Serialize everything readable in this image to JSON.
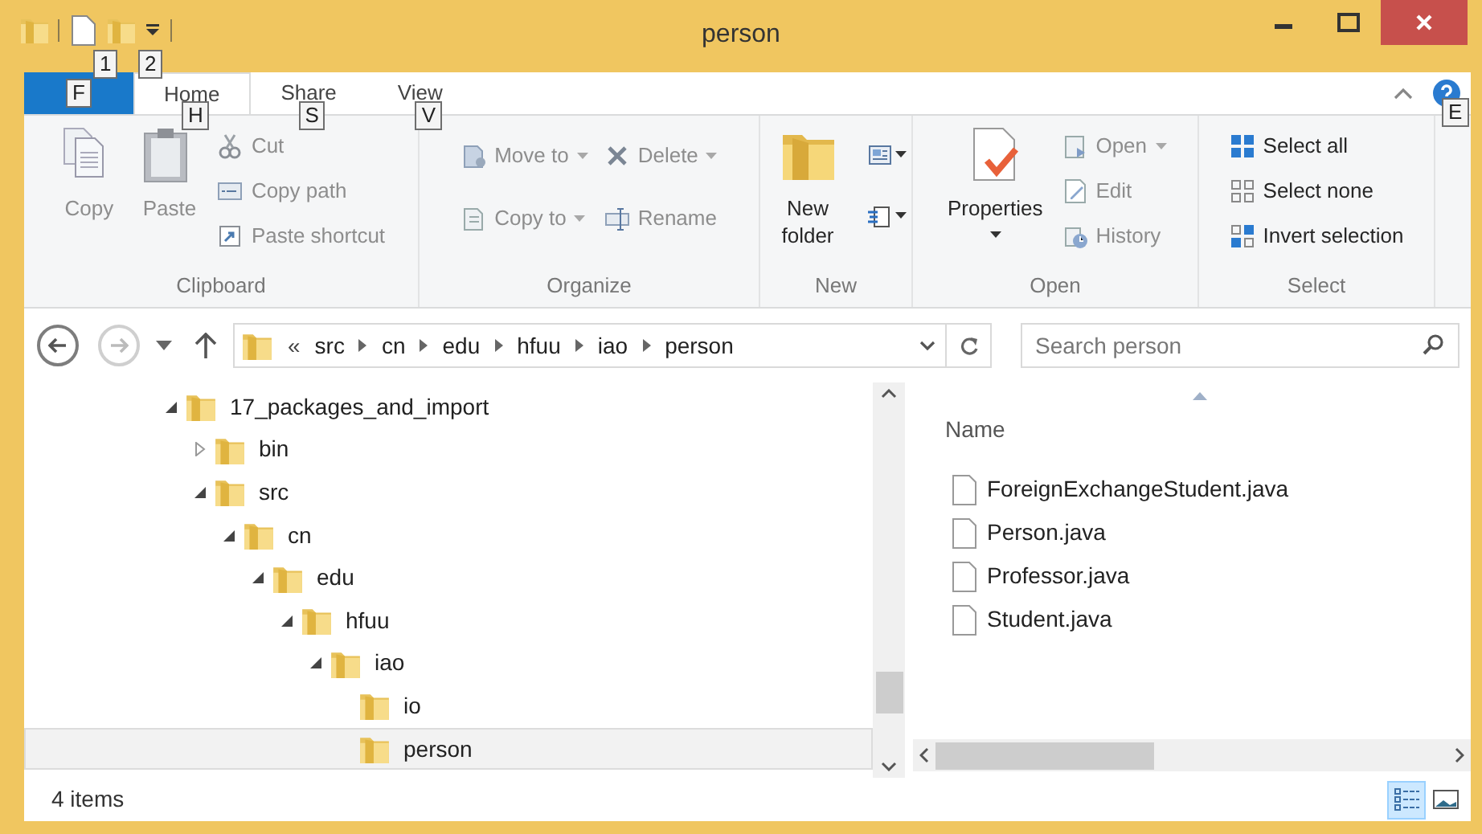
{
  "window": {
    "title": "person"
  },
  "quick_access": {
    "keytips": [
      "1",
      "2"
    ]
  },
  "file_tab": {
    "keytip": "F"
  },
  "tabs": [
    {
      "label": "Home",
      "keytip": "H",
      "selected": true
    },
    {
      "label": "Share",
      "keytip": "S",
      "selected": false
    },
    {
      "label": "View",
      "keytip": "V",
      "selected": false
    }
  ],
  "help": {
    "keytip": "E"
  },
  "ribbon_groups": [
    {
      "label": "Clipboard",
      "columns": [
        [
          {
            "kind": "large",
            "label": "Copy",
            "disabled": true
          }
        ],
        [
          {
            "kind": "large",
            "label": "Paste",
            "disabled": true
          }
        ],
        [
          {
            "kind": "small",
            "label": "Cut",
            "disabled": true
          },
          {
            "kind": "small",
            "label": "Copy path",
            "disabled": true
          },
          {
            "kind": "small",
            "label": "Paste shortcut",
            "disabled": true
          }
        ]
      ]
    },
    {
      "label": "Organize",
      "columns": [
        [
          {
            "kind": "small",
            "label": "Move to",
            "disabled": true,
            "dropdown": true
          },
          {
            "kind": "small",
            "label": "Copy to",
            "disabled": true,
            "dropdown": true
          }
        ],
        [
          {
            "kind": "small",
            "label": "Delete",
            "disabled": true,
            "dropdown": true
          },
          {
            "kind": "small",
            "label": "Rename",
            "disabled": true
          }
        ]
      ]
    },
    {
      "label": "New",
      "columns": [
        [
          {
            "kind": "large",
            "label": "New folder",
            "disabled": false
          }
        ],
        [
          {
            "kind": "icon",
            "disabled": false,
            "dropdown": true
          },
          {
            "kind": "icon",
            "disabled": false,
            "dropdown": true
          }
        ]
      ]
    },
    {
      "label": "Open",
      "columns": [
        [
          {
            "kind": "large",
            "label": "Properties",
            "disabled": false,
            "dropdown": true
          }
        ],
        [
          {
            "kind": "small",
            "label": "Open",
            "disabled": true,
            "dropdown": true
          },
          {
            "kind": "small",
            "label": "Edit",
            "disabled": true
          },
          {
            "kind": "small",
            "label": "History",
            "disabled": true
          }
        ]
      ]
    },
    {
      "label": "Select",
      "columns": [
        [
          {
            "kind": "small",
            "label": "Select all",
            "disabled": false
          },
          {
            "kind": "small",
            "label": "Select none",
            "disabled": false
          },
          {
            "kind": "small",
            "label": "Invert selection",
            "disabled": false
          }
        ]
      ]
    }
  ],
  "address_bar": {
    "overflow": "«",
    "crumbs": [
      "src",
      "cn",
      "edu",
      "hfuu",
      "iao",
      "person"
    ]
  },
  "search": {
    "placeholder": "Search person"
  },
  "nav_tree": [
    {
      "label": "17_packages_and_import",
      "expanded": true,
      "selected": false,
      "children": [
        {
          "label": "bin",
          "expanded": false,
          "selected": false
        },
        {
          "label": "src",
          "expanded": true,
          "selected": false,
          "children": [
            {
              "label": "cn",
              "expanded": true,
              "selected": false,
              "children": [
                {
                  "label": "edu",
                  "expanded": true,
                  "selected": false,
                  "children": [
                    {
                      "label": "hfuu",
                      "expanded": true,
                      "selected": false,
                      "children": [
                        {
                          "label": "iao",
                          "expanded": true,
                          "selected": false,
                          "children": [
                            {
                              "label": "io",
                              "selected": false
                            },
                            {
                              "label": "person",
                              "selected": true
                            }
                          ]
                        }
                      ]
                    }
                  ]
                }
              ]
            }
          ]
        }
      ]
    }
  ],
  "file_list": {
    "columns": [
      "Name"
    ],
    "files": [
      "ForeignExchangeStudent.java",
      "Person.java",
      "Professor.java",
      "Student.java"
    ]
  },
  "status_bar": {
    "item_count": "4 items",
    "views": [
      {
        "kind": "details",
        "selected": true
      },
      {
        "kind": "large_icons",
        "selected": false
      }
    ]
  }
}
